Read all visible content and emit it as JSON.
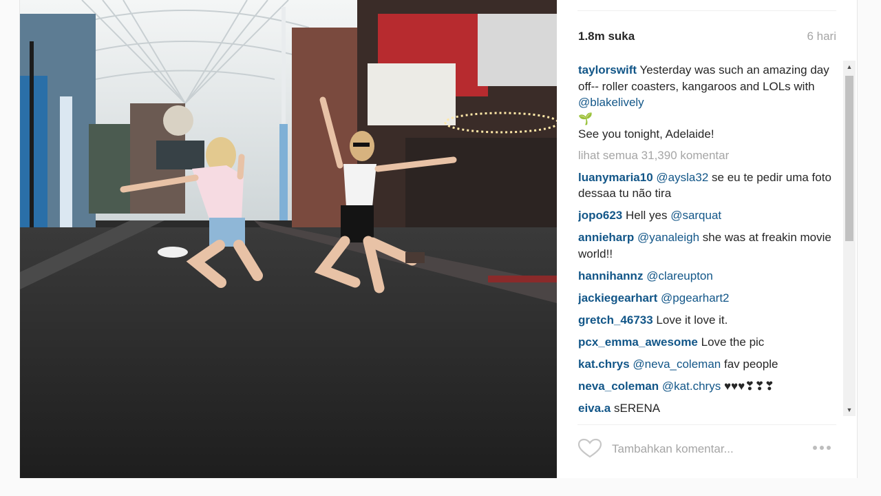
{
  "post": {
    "likes": "1.8m suka",
    "age": "6 hari",
    "caption": {
      "user": "taylorswift",
      "text": "Yesterday was such an amazing day off-- roller coasters, kangaroos and LOLs with",
      "mention": "@blakelively",
      "emoji": "🌱",
      "line2": "See you tonight, Adelaide!"
    },
    "view_all": "lihat semua 31,390 komentar",
    "comments": [
      {
        "user": "luanymaria10",
        "mention": "@aysla32",
        "text": "se eu te pedir uma foto dessaa tu não tira"
      },
      {
        "user": "jopo623",
        "mention": "",
        "text": "Hell yes",
        "mention_after": "@sarquat"
      },
      {
        "user": "annieharp",
        "mention": "@yanaleigh",
        "text": "she was at freakin movie world!!"
      },
      {
        "user": "hannihannz",
        "mention": "@clareupton",
        "text": ""
      },
      {
        "user": "jackiegearhart",
        "mention": "@pgearhart2",
        "text": ""
      },
      {
        "user": "gretch_46733",
        "mention": "",
        "text": "Love it love it."
      },
      {
        "user": "pcx_emma_awesome",
        "mention": "",
        "text": "Love the pic"
      },
      {
        "user": "kat.chrys",
        "mention": "@neva_coleman",
        "text": "fav people"
      },
      {
        "user": "neva_coleman",
        "mention": "@kat.chrys",
        "text": "♥♥♥❣❣❣"
      },
      {
        "user": "eiva.a",
        "mention": "",
        "text": "sERENA"
      }
    ],
    "comment_placeholder": "Tambahkan komentar...",
    "icons": {
      "like": "heart-icon",
      "more": "more-options-icon",
      "scroll_up": "scroll-up-arrow-icon",
      "scroll_down": "scroll-down-arrow-icon"
    },
    "colors": {
      "username": "#125688",
      "muted": "#a5a5a5",
      "text": "#262626"
    }
  }
}
